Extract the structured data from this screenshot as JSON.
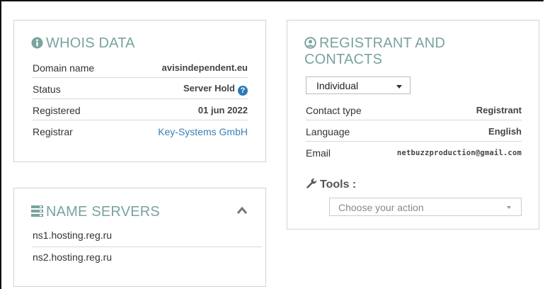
{
  "whois": {
    "title": "WHOIS DATA",
    "rows": [
      {
        "label": "Domain name",
        "value": "avisindependent.eu"
      },
      {
        "label": "Status",
        "value": "Server Hold"
      },
      {
        "label": "Registered",
        "value": "01 jun 2022"
      },
      {
        "label": "Registrar",
        "value": "Key-Systems GmbH"
      }
    ],
    "help_glyph": "?"
  },
  "name_servers": {
    "title": "NAME SERVERS",
    "items": [
      "ns1.hosting.reg.ru",
      "ns2.hosting.reg.ru"
    ]
  },
  "registrant": {
    "title_line1": "REGISTRANT AND",
    "title_line2": "CONTACTS",
    "contact_select": "Individual",
    "rows": [
      {
        "label": "Contact type",
        "value": "Registrant"
      },
      {
        "label": "Language",
        "value": "English"
      },
      {
        "label": "Email",
        "value": "netbuzzproduction@gmail.com"
      }
    ],
    "tools_label": "Tools :",
    "action_placeholder": "Choose your action"
  },
  "colors": {
    "title_accent": "#7aa39f",
    "link": "#3a7fb5",
    "help_icon": "#2a7ab8"
  },
  "icons": {
    "whois": "info-circle-icon",
    "name_servers": "server-icon",
    "collapse": "chevron-up-icon",
    "registrant": "user-circle-icon",
    "tools": "wrench-icon",
    "help": "question-circle-icon"
  }
}
